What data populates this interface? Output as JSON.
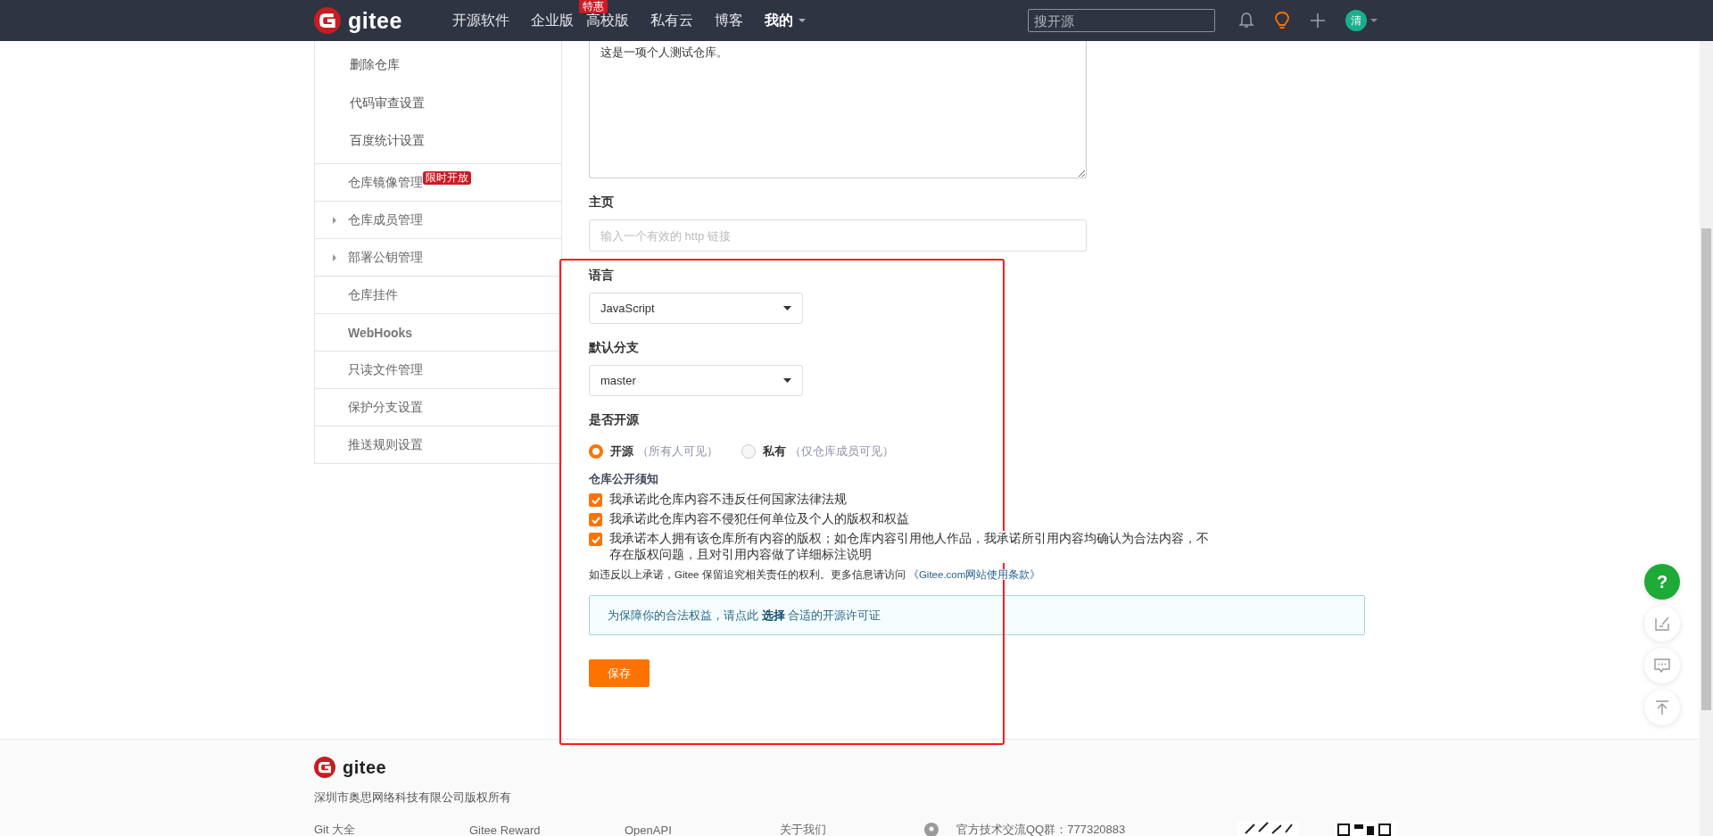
{
  "nav": {
    "logo": "gitee",
    "items": [
      {
        "label": "开源软件"
      },
      {
        "label": "企业版",
        "badge": "特惠"
      },
      {
        "label": "高校版"
      },
      {
        "label": "私有云"
      },
      {
        "label": "博客"
      }
    ],
    "menu": {
      "label": "我的"
    },
    "search": {
      "placeholder": "搜开源"
    },
    "avatar": "清"
  },
  "sidebar": {
    "items": [
      {
        "kind": "sub",
        "label": "删除仓库"
      },
      {
        "kind": "sub",
        "label": "代码审查设置"
      },
      {
        "kind": "sub",
        "label": "百度统计设置"
      },
      {
        "kind": "item",
        "label": "仓库镜像管理",
        "badge": "限时开放"
      },
      {
        "kind": "group",
        "label": "仓库成员管理",
        "expanded": false
      },
      {
        "kind": "group",
        "label": "部署公钥管理",
        "expanded": false
      },
      {
        "kind": "item",
        "label": "仓库挂件"
      },
      {
        "kind": "item",
        "label": "WebHooks",
        "bold": true
      },
      {
        "kind": "item",
        "label": "只读文件管理"
      },
      {
        "kind": "item",
        "label": "保护分支设置"
      },
      {
        "kind": "item",
        "label": "推送规则设置"
      }
    ]
  },
  "form": {
    "description": {
      "value": "这是一项个人测试仓库。"
    },
    "homepage": {
      "label": "主页",
      "placeholder": "输入一个有效的 http 链接"
    },
    "language": {
      "label": "语言",
      "value": "JavaScript"
    },
    "branch": {
      "label": "默认分支",
      "value": "master"
    },
    "visibility": {
      "label": "是否开源",
      "options": [
        {
          "label": "开源",
          "hint": "（所有人可见）",
          "selected": true
        },
        {
          "label": "私有",
          "hint": "（仅仓库成员可见）",
          "selected": false
        }
      ]
    },
    "notice": {
      "title": "仓库公开须知",
      "pledges": [
        {
          "text": "我承诺此仓库内容不违反任何国家法律法规",
          "checked": true
        },
        {
          "text": "我承诺此仓库内容不侵犯任何单位及个人的版权和权益",
          "checked": true
        },
        {
          "text": "我承诺本人拥有该仓库所有内容的版权；如仓库内容引用他人作品，我承诺所引用内容均确认为合法内容，不存在版权问题，且对引用内容做了详细标注说明",
          "checked": true
        }
      ],
      "note": "如违反以上承诺，Gitee 保留追究相关责任的权利。更多信息请访问 ",
      "link": "《Gitee.com网站使用条款》"
    },
    "license_tip": "为保障你的合法权益，请点此 **选择** 合适的开源许可证",
    "save": "保存"
  },
  "footer": {
    "logo": "gitee",
    "copyright": "深圳市奥思网络科技有限公司版权所有",
    "links": [
      "Git 大全",
      "Gitee Reward",
      "OpenAPI",
      "关于我们"
    ],
    "contact": "官方技术交流QQ群：777320883"
  },
  "float_buttons": [
    {
      "kind": "help",
      "label": "?"
    },
    {
      "kind": "edit"
    },
    {
      "kind": "comment"
    },
    {
      "kind": "top"
    }
  ]
}
